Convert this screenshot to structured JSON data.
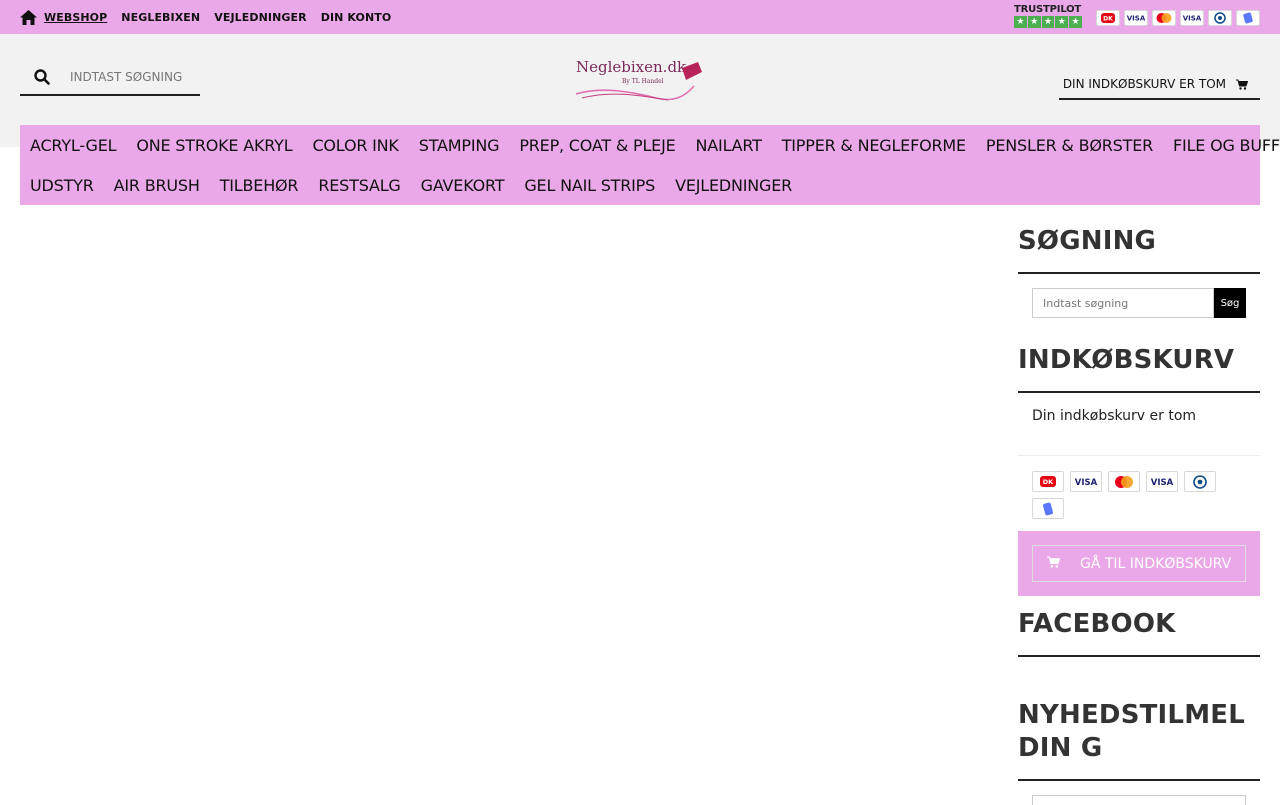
{
  "topnav": {
    "items": [
      {
        "label": "WEBSHOP"
      },
      {
        "label": "NEGLEBIXEN"
      },
      {
        "label": "VEJLEDNINGER"
      },
      {
        "label": "DIN KONTO"
      }
    ]
  },
  "trustpilot": {
    "label": "TRUSTPILOT",
    "stars": 5
  },
  "payment_cards": [
    "dankort",
    "visa-electron",
    "mastercard",
    "visa",
    "diners-club",
    "mobilepay"
  ],
  "header": {
    "search_placeholder": "INDTAST SØGNING",
    "logo_text": "Neglebixen.dk",
    "logo_sub": "By TL Handel",
    "cart_text": "DIN INDKØBSKURV ER TOM"
  },
  "categories": {
    "row1": [
      "ACRYL-GEL",
      "ONE STROKE AKRYL",
      "COLOR INK",
      "STAMPING",
      "PREP, COAT & PLEJE",
      "NAILART",
      "TIPPER & NEGLEFORME",
      "PENSLER & BØRSTER",
      "FILE OG BUFFERS"
    ],
    "row2": [
      "UDSTYR",
      "AIR BRUSH",
      "TILBEHØR",
      "RESTSALG",
      "GAVEKORT",
      "GEL NAIL STRIPS",
      "VEJLEDNINGER"
    ]
  },
  "sidebar": {
    "search_title": "SØGNING",
    "search_placeholder": "Indtast søgning",
    "search_button": "Søg",
    "cart_title": "INDKØBSKURV",
    "cart_text": "Din indkøbskurv er tom",
    "goto_cart": "GÅ TIL INDKØBSKURV",
    "facebook_title": "FACEBOOK",
    "newsletter_title": "NYHEDSTILMELDIN G"
  },
  "colors": {
    "accent": "#eba8e8",
    "header_bg": "#f2f2f2"
  }
}
